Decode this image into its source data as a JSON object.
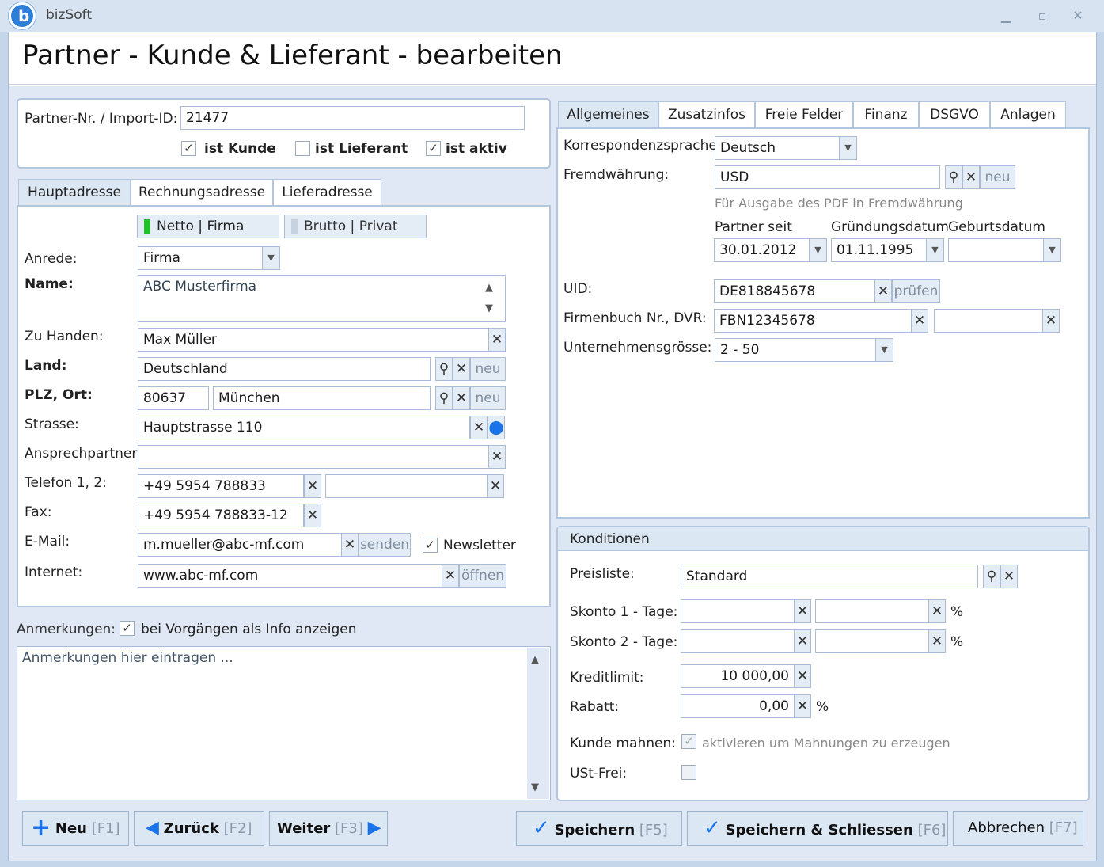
{
  "app": {
    "title": "bizSoft"
  },
  "page_title": "Partner - Kunde & Lieferant - bearbeiten",
  "partner": {
    "nr_label": "Partner-Nr. / Import-ID:",
    "nr_value": "21477",
    "ist_kunde": "ist Kunde",
    "ist_lieferant": "ist Lieferant",
    "ist_aktiv": "ist aktiv"
  },
  "address_tabs": [
    "Hauptadresse",
    "Rechnungsadresse",
    "Lieferadresse"
  ],
  "mode": {
    "netto": "Netto | Firma",
    "brutto": "Brutto | Privat"
  },
  "address": {
    "anrede_label": "Anrede:",
    "anrede_value": "Firma",
    "name_label": "Name:",
    "name_value": "ABC Musterfirma",
    "zuhanden_label": "Zu Handen:",
    "zuhanden_value": "Max Müller",
    "land_label": "Land:",
    "land_value": "Deutschland",
    "plz_label": "PLZ, Ort:",
    "plz_value": "80637",
    "ort_value": "München",
    "strasse_label": "Strasse:",
    "strasse_value": "Hauptstrasse 110",
    "ansprech_label": "Ansprechpartner:",
    "ansprech_value": "",
    "telefon_label": "Telefon 1, 2:",
    "telefon1_value": "+49 5954 788833",
    "telefon2_value": "",
    "fax_label": "Fax:",
    "fax_value": "+49 5954 788833-12",
    "email_label": "E-Mail:",
    "email_value": "m.mueller@abc-mf.com",
    "internet_label": "Internet:",
    "internet_value": "www.abc-mf.com",
    "newsletter": "Newsletter",
    "neu": "neu",
    "senden": "senden",
    "oeffnen": "öffnen"
  },
  "notes": {
    "label": "Anmerkungen:",
    "checkbox": "bei Vorgängen als Info anzeigen",
    "placeholder": "Anmerkungen hier eintragen ..."
  },
  "right_tabs": [
    "Allgemeines",
    "Zusatzinfos",
    "Freie Felder",
    "Finanz",
    "DSGVO",
    "Anlagen"
  ],
  "general": {
    "korr_label": "Korrespondenzsprache:",
    "korr_value": "Deutsch",
    "fremd_label": "Fremdwährung:",
    "fremd_value": "USD",
    "fremd_hint": "Für Ausgabe des PDF in Fremdwährung",
    "partner_seit_label": "Partner seit",
    "partner_seit_value": "30.01.2012",
    "gruendung_label": "Gründungsdatum",
    "gruendung_value": "01.11.1995",
    "geburt_label": "Geburtsdatum",
    "geburt_value": "",
    "uid_label": "UID:",
    "uid_value": "DE818845678",
    "pruefen": "prüfen",
    "firmenbuch_label": "Firmenbuch Nr., DVR:",
    "firmenbuch_value": "FBN12345678",
    "dvr_value": "",
    "groesse_label": "Unternehmensgrösse:",
    "groesse_value": "2 - 50",
    "neu": "neu"
  },
  "conditions": {
    "title": "Konditionen",
    "preisliste_label": "Preisliste:",
    "preisliste_value": "Standard",
    "skonto1_label": "Skonto 1 - Tage:",
    "skonto2_label": "Skonto 2 - Tage:",
    "percent": "%",
    "kreditlimit_label": "Kreditlimit:",
    "kreditlimit_value": "10 000,00",
    "rabatt_label": "Rabatt:",
    "rabatt_value": "0,00",
    "mahnen_label": "Kunde mahnen:",
    "mahnen_text": "aktivieren um Mahnungen zu erzeugen",
    "ust_label": "USt-Frei:"
  },
  "buttons": {
    "neu": "Neu",
    "neu_key": "[F1]",
    "zurueck": "Zurück",
    "zurueck_key": "[F2]",
    "weiter": "Weiter",
    "weiter_key": "[F3]",
    "speichern": "Speichern",
    "speichern_key": "[F5]",
    "speichern_schliessen": "Speichern & Schliessen",
    "speichern_schliessen_key": "[F6]",
    "abbrechen": "Abbrechen",
    "abbrechen_key": "[F7]"
  },
  "colors": {
    "accent": "#1a73e8",
    "netto_indicator": "#22c02a",
    "panel_bg": "#dfe8f4"
  }
}
